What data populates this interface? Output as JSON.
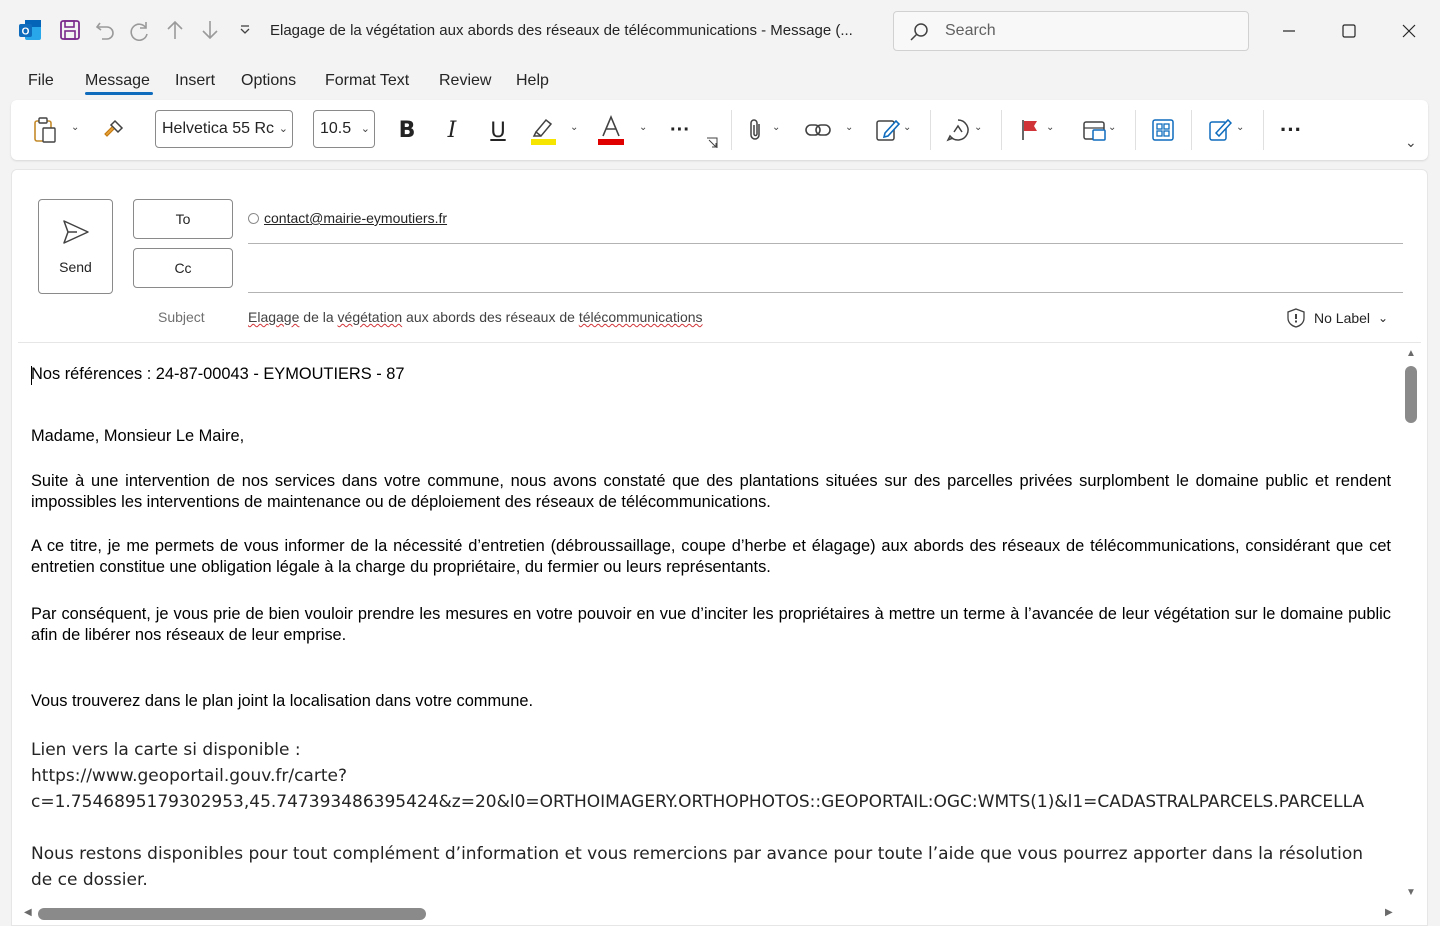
{
  "window": {
    "title": "Elagage de la végétation aux abords des réseaux de télécommunications  -  Message (...",
    "search_placeholder": "Search"
  },
  "menu": [
    "File",
    "Message",
    "Insert",
    "Options",
    "Format Text",
    "Review",
    "Help"
  ],
  "menu_active": "Message",
  "ribbon": {
    "font_name": "Helvetica 55 Rc",
    "font_size": "10.5",
    "highlight_color": "#f5e500",
    "font_color": "#e00000"
  },
  "compose": {
    "send_label": "Send",
    "to_label": "To",
    "cc_label": "Cc",
    "to_recipient": "contact@mairie-eymoutiers.fr",
    "subject_label": "Subject",
    "subject_words": [
      "Elagage",
      " de la ",
      "végétation",
      " aux abords des réseaux de ",
      "télécommunications"
    ],
    "sensitivity_label": "No Label"
  },
  "body": {
    "references": "Nos références : 24-87-00043   - EYMOUTIERS  - 87",
    "greeting": "Madame, Monsieur Le Maire,",
    "para1": "Suite à une intervention de nos services dans votre commune, nous avons constaté que des plantations situées sur des parcelles privées surplombent le domaine public et rendent impossibles les interventions de maintenance ou de déploiement des réseaux de télécommunications.",
    "para2": "A ce titre, je me permets de vous informer de la nécessité d’entretien (débroussaillage, coupe d’herbe et élagage) aux abords des réseaux de télécommunications, considérant que cet entretien constitue une obligation légale à la charge du propriétaire, du fermier ou leurs représentants.",
    "para3": "Par conséquent, je vous prie de bien vouloir prendre les mesures en votre pouvoir en vue d’inciter les propriétaires à mettre un terme à l’avancée de leur végétation sur le domaine public afin de libérer nos réseaux de leur emprise.",
    "para4": "Vous trouverez dans le plan joint la localisation dans votre commune.",
    "map_link_label": "Lien vers la carte si disponible :",
    "map_link_line1": "https://www.geoportail.gouv.fr/carte?",
    "map_link_line2": "c=1.7546895179302953,45.747393486395424&z=20&l0=ORTHOIMAGERY.ORTHOPHOTOS::GEOPORTAIL:OGC:WMTS(1)&l1=CADASTRALPARCELS.PARCELLA",
    "closing": "Nous restons disponibles pour tout complément d’information et vous remercions par avance pour toute l’aide que vous pourrez apporter dans la résolution de ce dossier."
  }
}
